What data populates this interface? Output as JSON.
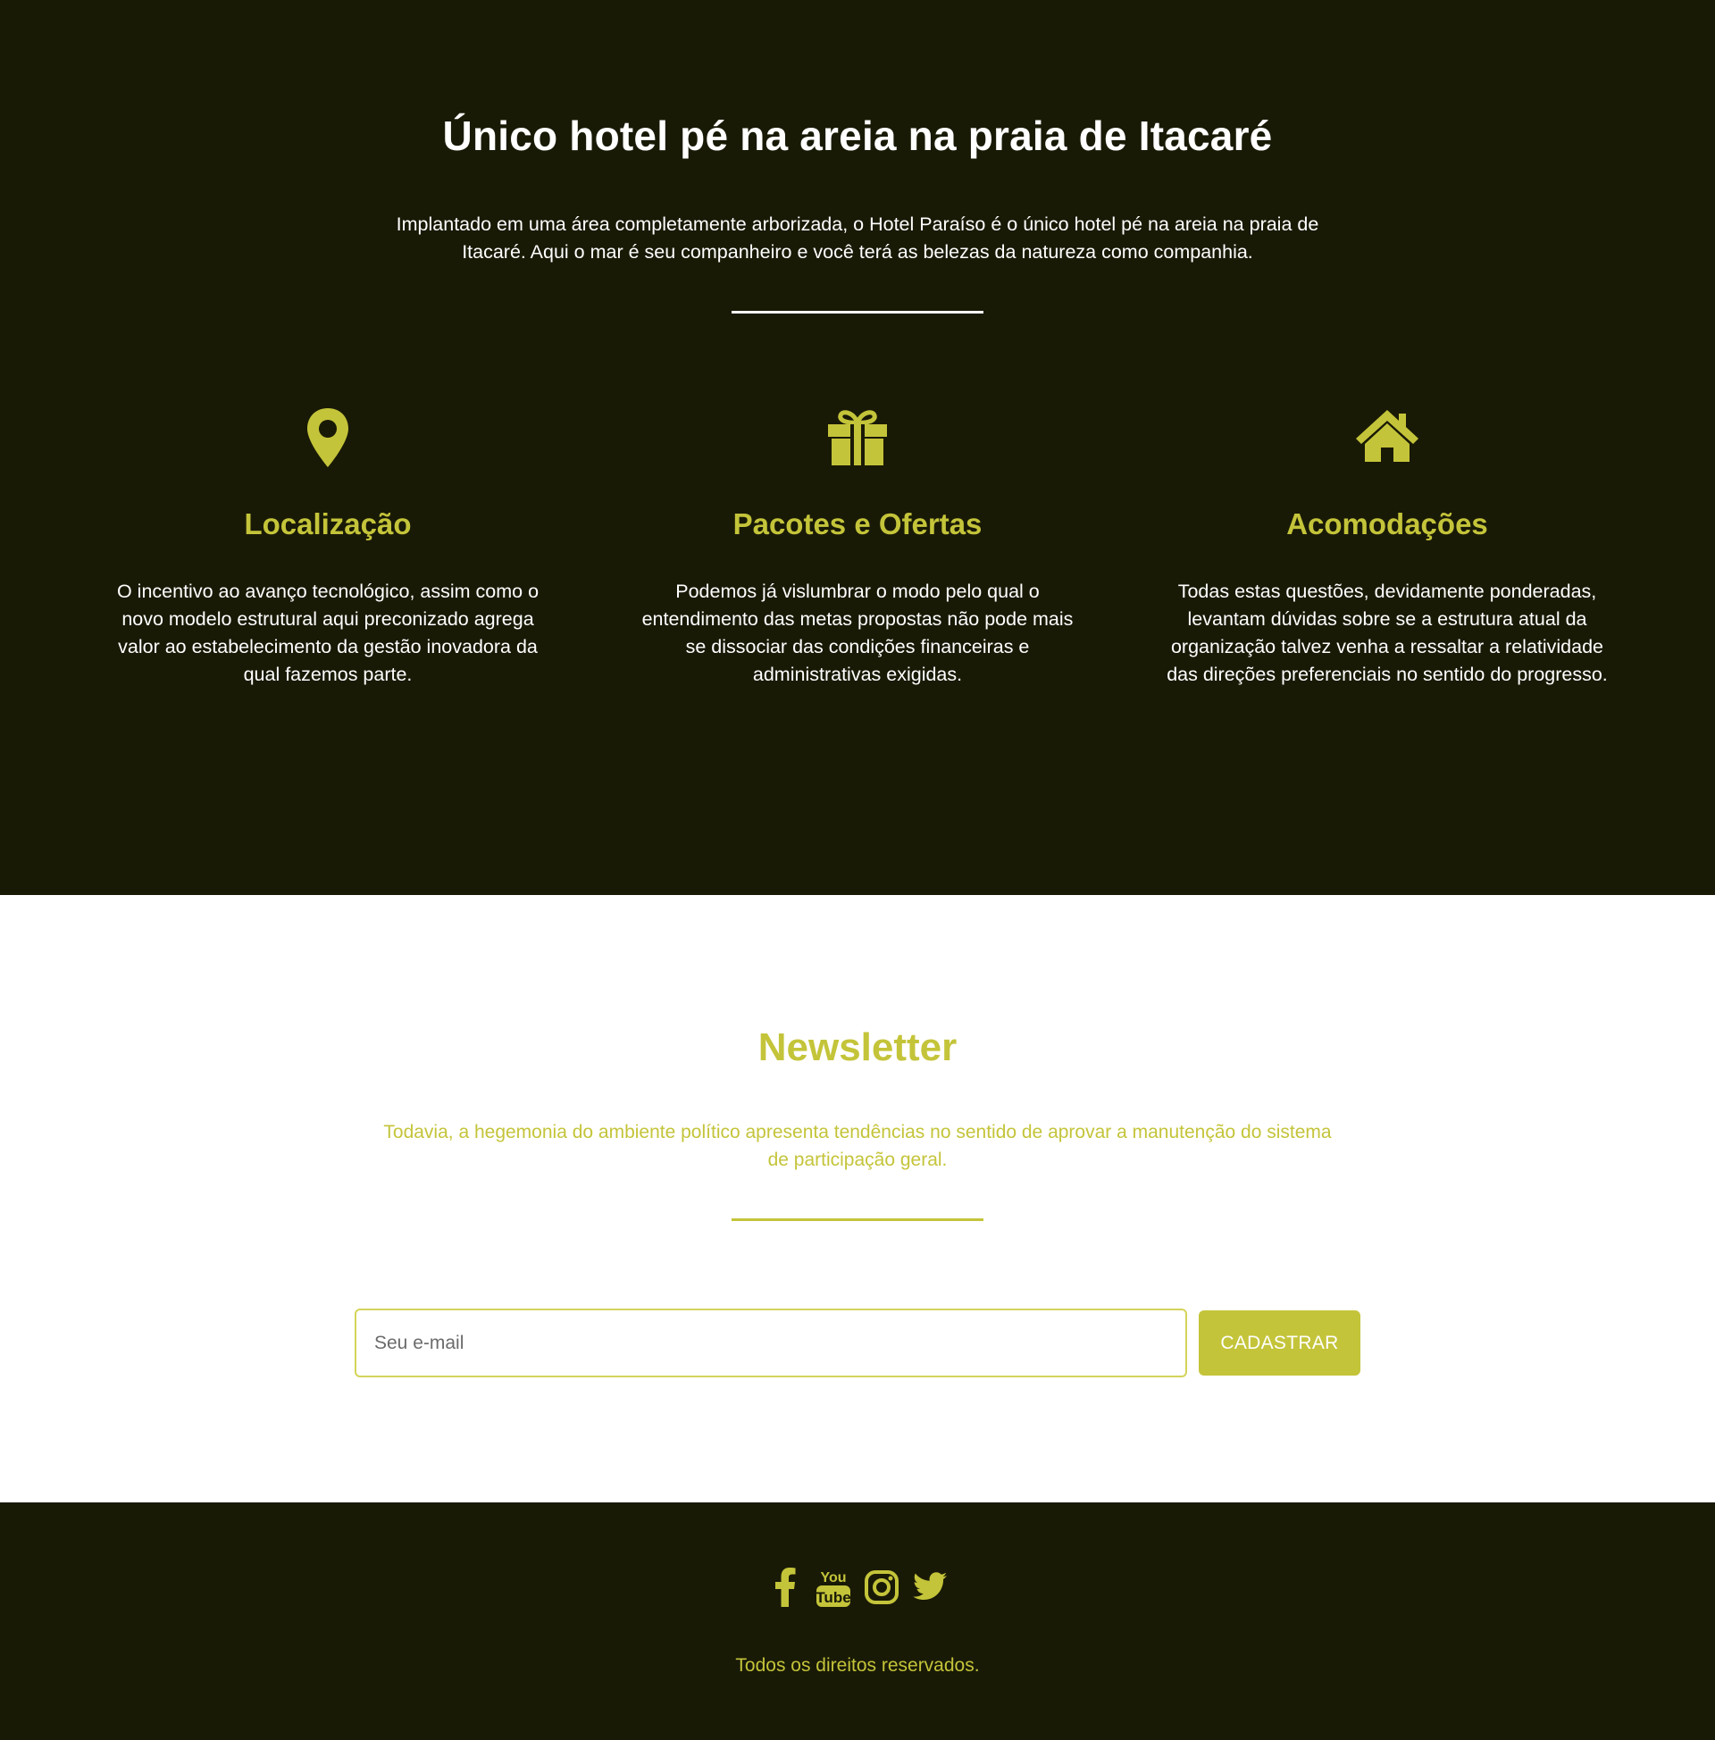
{
  "colors": {
    "dark_bg": "#191a06",
    "accent": "#c4c43a",
    "white": "#ffffff"
  },
  "hero": {
    "title": "Único hotel pé na areia na praia de Itacaré",
    "intro": "Implantado em uma área completamente arborizada, o Hotel Paraíso é o único hotel pé na areia na praia de Itacaré. Aqui o mar é seu companheiro e você terá as belezas da natureza como companhia."
  },
  "features": [
    {
      "icon": "map-marker-icon",
      "title": "Localização",
      "text": "O incentivo ao avanço tecnológico, assim como o novo modelo estrutural aqui preconizado agrega valor ao estabelecimento da gestão inovadora da qual fazemos parte."
    },
    {
      "icon": "gift-icon",
      "title": "Pacotes e Ofertas",
      "text": "Podemos já vislumbrar o modo pelo qual o entendimento das metas propostas não pode mais se dissociar das condições financeiras e administrativas exigidas."
    },
    {
      "icon": "home-icon",
      "title": "Acomodações",
      "text": "Todas estas questões, devidamente ponderadas, levantam dúvidas sobre se a estrutura atual da organização talvez venha a ressaltar a relatividade das direções preferenciais no sentido do progresso."
    }
  ],
  "newsletter": {
    "title": "Newsletter",
    "text": "Todavia, a hegemonia do ambiente político apresenta tendências no sentido de aprovar a manutenção do sistema de participação geral.",
    "email_placeholder": "Seu e-mail",
    "button_label": "CADASTRAR"
  },
  "footer": {
    "socials": [
      "facebook-icon",
      "youtube-icon",
      "instagram-icon",
      "twitter-icon"
    ],
    "copyright": "Todos os direitos reservados."
  }
}
